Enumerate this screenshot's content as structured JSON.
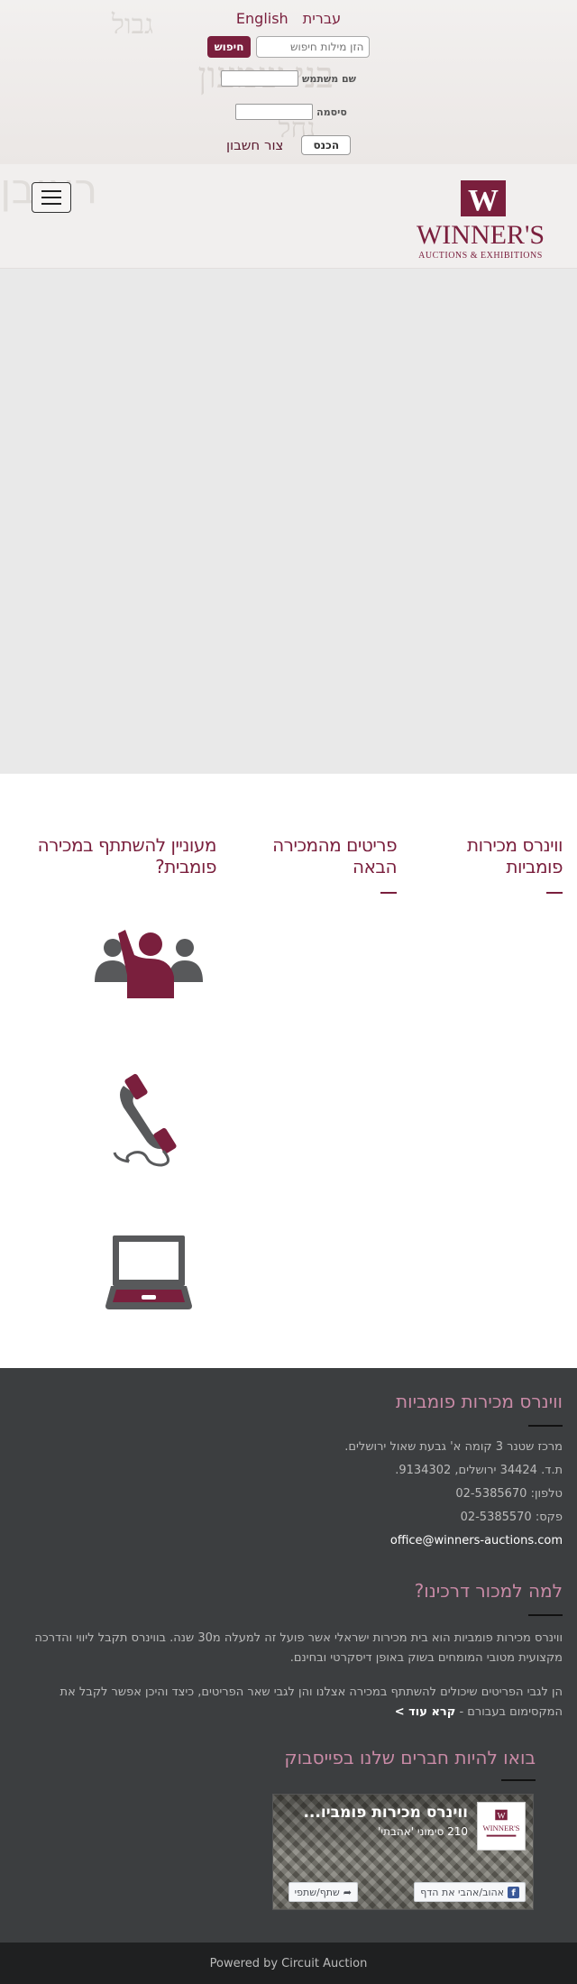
{
  "topbar": {
    "lang_english": "English",
    "lang_hebrew": "עברית",
    "search_placeholder": "הזן מילות חיפוש",
    "search_button": "חיפוש",
    "username_label": "שם משתמש",
    "password_label": "סיסמה",
    "login_button": "הכנס",
    "register_link": "צור חשבון"
  },
  "navbar": {
    "logo_alt": "Winner's Auctions & Exhibitions",
    "logo_text": "WINNER'S",
    "logo_subtext": "AUCTIONS & EXHIBITIONS"
  },
  "tabs": [
    {
      "label": "ווינרס מכירות פומביות"
    },
    {
      "label": "פריטים מהמכירה הבאה"
    },
    {
      "label": "מעוניין להשתתף במכירה פומבית?"
    }
  ],
  "icons": [
    "raise-hand-icon",
    "phone-icon",
    "laptop-icon"
  ],
  "footer": {
    "about_title": "ווינרס מכירות פומביות",
    "address": "מרכז שטנר 3 קומה א' גבעת שאול ירושלים.",
    "pobox": "ת.ד. 34424 ירושלים, 9134302.",
    "phone": "טלפון: 02-5385670",
    "fax": "פקס: 02-5385570",
    "email": "office@winners-auctions.com",
    "why_title": "למה למכור דרכינו?",
    "why_para1": "ווינרס מכירות פומביות הוא בית מכירות ישראלי אשר פועל זה למעלה מ30 שנה. בווינרס תקבל ליווי והדרכה מקצועית מטובי המומחים בשוק באופן דיסקרטי ובחינם.",
    "why_para2": "הן לגבי הפריטים שיכולים להשתתף במכירה אצלנו והן לגבי שאר הפריטים, כיצד והיכן אפשר לקבל את המקסימום בעבורם -",
    "read_more": "קרא עוד >",
    "facebook_title": "בואו להיות חברים שלנו בפייסבוק",
    "fb_page_name": "ווינרס מכירות פומביו...",
    "fb_likes": "210 סימוני 'אהבתי'",
    "fb_like_button": "אהוב/אהבי את הדף",
    "fb_share_button": "שתף/שתפי"
  },
  "bottom": {
    "powered_by": "Powered by Circuit Auction"
  },
  "colors": {
    "brand": "#7a1f3d",
    "footer_bg": "#3c3e40",
    "footer_title": "#c98aa6",
    "icon_gray": "#58595b"
  }
}
